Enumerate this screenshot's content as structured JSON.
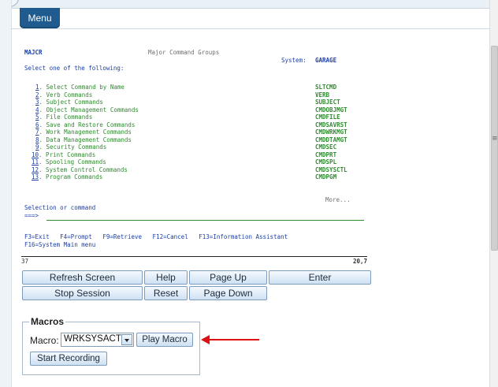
{
  "menu_tab": {
    "label": "Menu"
  },
  "screen": {
    "menu_id": "MAJCR",
    "title": "Major Command Groups",
    "system_label": "System:",
    "system_name": "GARAGE",
    "prompt": "Select one of the following:",
    "options": [
      {
        "num": "1",
        "label": ". Select Command by Name",
        "command": "SLTCMD"
      },
      {
        "num": "2",
        "label": ". Verb Commands",
        "command": "VERB"
      },
      {
        "num": "3",
        "label": ". Subject Commands",
        "command": "SUBJECT"
      },
      {
        "num": "4",
        "label": ". Object Management Commands",
        "command": "CMDOBJMGT"
      },
      {
        "num": "5",
        "label": ". File Commands",
        "command": "CMDFILE"
      },
      {
        "num": "6",
        "label": ". Save and Restore Commands",
        "command": "CMDSAVRST"
      },
      {
        "num": "7",
        "label": ". Work Management Commands",
        "command": "CMDWRKMGT"
      },
      {
        "num": "8",
        "label": ". Data Management Commands",
        "command": "CMDDTAMGT"
      },
      {
        "num": "9",
        "label": ". Security Commands",
        "command": "CMDSEC"
      },
      {
        "num": "10",
        "label": ". Print Commands",
        "command": "CMDPRT"
      },
      {
        "num": "11",
        "label": ". Spooling Commands",
        "command": "CMDSPL"
      },
      {
        "num": "12",
        "label": ". System Control Commands",
        "command": "CMDSYSCTL"
      },
      {
        "num": "13",
        "label": ". Program Commands",
        "command": "CMDPGM"
      }
    ],
    "more": "More...",
    "selection_label": "Selection or command",
    "selection_arrow": "===>",
    "fkeys_line1": "F3=Exit   F4=Prompt   F9=Retrieve   F12=Cancel   F13=Information Assistant",
    "fkeys_line2": "F16=System Main menu"
  },
  "status": {
    "left": "37",
    "right": "20,7"
  },
  "buttons": {
    "refresh": "Refresh Screen",
    "help": "Help",
    "page_up": "Page Up",
    "enter": "Enter",
    "stop_session": "Stop Session",
    "reset": "Reset",
    "page_down": "Page Down"
  },
  "macros": {
    "legend": "Macros",
    "label": "Macro:",
    "selected": "WRKSYSACT",
    "play": "Play Macro",
    "start_recording": "Start Recording"
  },
  "colors": {
    "menu_tab": "#1f5b8e",
    "terminal_blue": "#1a3ea5",
    "terminal_green": "#2e8b2e",
    "arrow_red": "#dd1111"
  }
}
